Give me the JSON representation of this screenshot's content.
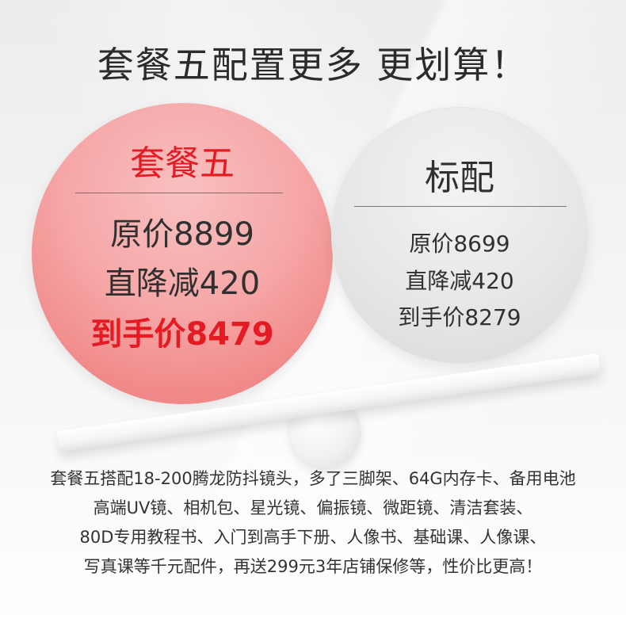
{
  "headline": "套餐五配置更多 更划算！",
  "package": {
    "title": "套餐五",
    "original_price": "原价8899",
    "discount": "直降减420",
    "final_price": "到手价8479"
  },
  "standard": {
    "title": "标配",
    "original_price": "原价8699",
    "discount": "直降减420",
    "final_price": "到手价8279"
  },
  "description": {
    "lines": [
      "套餐五搭配18-200腾龙防抖镜头，多了三脚架、64G内存卡、备用电池",
      "高端UV镜、相机包、星光镜、偏振镜、微距镜、清洁套装、",
      "80D专用教程书、入门到高手下册、人像书、基础课、人像课、",
      "写真课等千元配件，再送299元3年店铺保修等，性价比更高！"
    ]
  },
  "colors": {
    "accent_red": "#e41b23",
    "package_circle": "#f6a7a7",
    "standard_circle": "#e4e4e4",
    "text_dark": "#303030"
  }
}
